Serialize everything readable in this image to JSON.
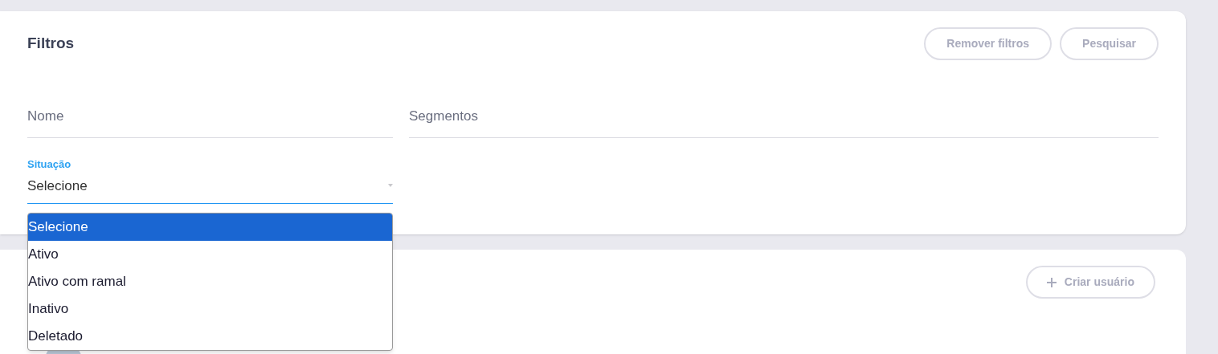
{
  "filters": {
    "title": "Filtros",
    "buttons": [
      "Remover filtros",
      "Pesquisar"
    ],
    "fields": [
      {
        "placeholder": "Nome"
      },
      {
        "placeholder": "Segmentos"
      }
    ],
    "situacao": {
      "label": "Situação",
      "value": "Selecione",
      "expanded": true,
      "options": [
        {
          "label": "Selecione",
          "selected": true
        },
        {
          "label": "Ativo",
          "selected": false
        },
        {
          "label": "Ativo com ramal",
          "selected": false
        },
        {
          "label": "Inativo",
          "selected": false
        },
        {
          "label": "Deletado",
          "selected": false
        }
      ]
    }
  },
  "users": {
    "create_button": "Criar usuário"
  }
}
